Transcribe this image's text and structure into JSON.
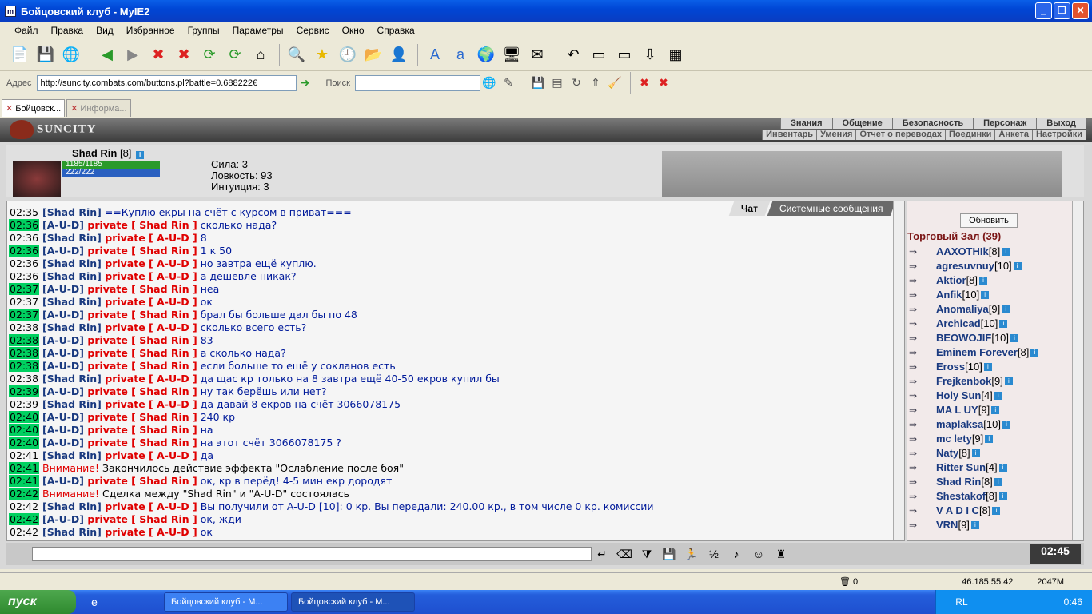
{
  "window": {
    "title": "Бойцовский клуб - MyIE2"
  },
  "menu": [
    "Файл",
    "Правка",
    "Вид",
    "Избранное",
    "Группы",
    "Параметры",
    "Сервис",
    "Окно",
    "Справка"
  ],
  "address": {
    "label": "Адрес",
    "url": "http://suncity.combats.com/buttons.pl?battle=0.688222€",
    "search_label": "Поиск"
  },
  "tabs": [
    "Бойцовск...",
    "Информа..."
  ],
  "game": {
    "logo": "SUNCITY",
    "nav_top": [
      "Знания",
      "Общение",
      "Безопасность",
      "Персонаж",
      "Выход"
    ],
    "nav_sub": [
      "Инвентарь",
      "Умения",
      "Отчет о переводах",
      "Поединки",
      "Анкета",
      "Настройки"
    ],
    "character": {
      "name": "Shad Rin",
      "level": "[8]",
      "hp": "1185/1185",
      "mp": "222/222",
      "stats": [
        "Сила: 3",
        "Ловкость: 93",
        "Интуиция: 3"
      ]
    },
    "chat_tabs": [
      "Чат",
      "Системные сообщения"
    ],
    "messages": [
      {
        "time": "02:35",
        "hl": false,
        "from": "[Shad Rin]",
        "to": "",
        "text": "==Куплю екры на счёт с курсом в приват==="
      },
      {
        "time": "02:36",
        "hl": true,
        "from": "[A-U-D]",
        "to": "private [ Shad Rin ]",
        "text": "сколько нада?"
      },
      {
        "time": "02:36",
        "hl": false,
        "from": "[Shad Rin]",
        "to": "private [ A-U-D ]",
        "text": "8"
      },
      {
        "time": "02:36",
        "hl": true,
        "from": "[A-U-D]",
        "to": "private [ Shad Rin ]",
        "text": "1 к 50"
      },
      {
        "time": "02:36",
        "hl": false,
        "from": "[Shad Rin]",
        "to": "private [ A-U-D ]",
        "text": "но завтра ещё куплю."
      },
      {
        "time": "02:36",
        "hl": false,
        "from": "[Shad Rin]",
        "to": "private [ A-U-D ]",
        "text": "а дешевле никак?"
      },
      {
        "time": "02:37",
        "hl": true,
        "from": "[A-U-D]",
        "to": "private [ Shad Rin ]",
        "text": "неа"
      },
      {
        "time": "02:37",
        "hl": false,
        "from": "[Shad Rin]",
        "to": "private [ A-U-D ]",
        "text": "ок"
      },
      {
        "time": "02:37",
        "hl": true,
        "from": "[A-U-D]",
        "to": "private [ Shad Rin ]",
        "text": "брал бы больше дал бы по 48"
      },
      {
        "time": "02:38",
        "hl": false,
        "from": "[Shad Rin]",
        "to": "private [ A-U-D ]",
        "text": "сколько всего есть?"
      },
      {
        "time": "02:38",
        "hl": true,
        "from": "[A-U-D]",
        "to": "private [ Shad Rin ]",
        "text": "83"
      },
      {
        "time": "02:38",
        "hl": true,
        "from": "[A-U-D]",
        "to": "private [ Shad Rin ]",
        "text": "а сколько нада?"
      },
      {
        "time": "02:38",
        "hl": true,
        "from": "[A-U-D]",
        "to": "private [ Shad Rin ]",
        "text": "если больше то ещё у сокланов есть"
      },
      {
        "time": "02:38",
        "hl": false,
        "from": "[Shad Rin]",
        "to": "private [ A-U-D ]",
        "text": "да щас кр только на 8 завтра ещё 40-50 екров купил бы"
      },
      {
        "time": "02:39",
        "hl": true,
        "from": "[A-U-D]",
        "to": "private [ Shad Rin ]",
        "text": "ну так берёшь или нет?"
      },
      {
        "time": "02:39",
        "hl": false,
        "from": "[Shad Rin]",
        "to": "private [ A-U-D ]",
        "text": "да давай 8 екров на счёт 3066078175"
      },
      {
        "time": "02:40",
        "hl": true,
        "from": "[A-U-D]",
        "to": "private [ Shad Rin ]",
        "text": "240 кр"
      },
      {
        "time": "02:40",
        "hl": true,
        "from": "[A-U-D]",
        "to": "private [ Shad Rin ]",
        "text": "на"
      },
      {
        "time": "02:40",
        "hl": true,
        "from": "[A-U-D]",
        "to": "private [ Shad Rin ]",
        "text": "на этот счёт 3066078175 ?"
      },
      {
        "time": "02:41",
        "hl": false,
        "from": "[Shad Rin]",
        "to": "private [ A-U-D ]",
        "text": "да"
      },
      {
        "time": "02:41",
        "hl": true,
        "warn": "Внимание!",
        "sys": "Закончилось действие эффекта \"Ослабление после боя\""
      },
      {
        "time": "02:41",
        "hl": true,
        "from": "[A-U-D]",
        "to": "private [ Shad Rin ]",
        "text": "ок, кр в перёд! 4-5 мин екр дородят"
      },
      {
        "time": "02:42",
        "hl": true,
        "warn": "Внимание!",
        "sys": "Сделка между \"Shad Rin\" и \"A-U-D\" состоялась"
      },
      {
        "time": "02:42",
        "hl": false,
        "from": "[Shad Rin]",
        "to": "private [ A-U-D ]",
        "text": "Вы получили от A-U-D [10]: 0 кр. Вы передали: 240.00 кр., в том числе 0 кр. комиссии"
      },
      {
        "time": "02:42",
        "hl": true,
        "from": "[A-U-D]",
        "to": "private [ Shad Rin ]",
        "text": "ок, жди"
      },
      {
        "time": "02:42",
        "hl": false,
        "from": "[Shad Rin]",
        "to": "private [ A-U-D ]",
        "text": "ок"
      }
    ],
    "room": {
      "refresh_label": "Обновить",
      "title": "Торговый Зал (39)",
      "users": [
        {
          "name": "AAXOTHIk",
          "lvl": "[8]"
        },
        {
          "name": "agresuvnuy",
          "lvl": "[10]"
        },
        {
          "name": "Aktior",
          "lvl": "[8]"
        },
        {
          "name": "Anfik",
          "lvl": "[10]"
        },
        {
          "name": "Anomaliya",
          "lvl": "[9]"
        },
        {
          "name": "Archicad",
          "lvl": "[10]"
        },
        {
          "name": "BEOWOJIF",
          "lvl": "[10]"
        },
        {
          "name": "Eminem Forever",
          "lvl": "[8]"
        },
        {
          "name": "Eross",
          "lvl": "[10]"
        },
        {
          "name": "Frejkenbok",
          "lvl": "[9]"
        },
        {
          "name": "Holy Sun",
          "lvl": "[4]"
        },
        {
          "name": "MA L UY",
          "lvl": "[9]"
        },
        {
          "name": "maplaksa",
          "lvl": "[10]"
        },
        {
          "name": "mc lety",
          "lvl": "[9]"
        },
        {
          "name": "Naty",
          "lvl": "[8]"
        },
        {
          "name": "Ritter Sun",
          "lvl": "[4]"
        },
        {
          "name": "Shad Rin",
          "lvl": "[8]"
        },
        {
          "name": "Shestakof",
          "lvl": "[8]"
        },
        {
          "name": "V A D I C",
          "lvl": "[8]"
        },
        {
          "name": "VRN",
          "lvl": "[9]"
        }
      ]
    },
    "clock": "02:45"
  },
  "statusbar": {
    "count": "0",
    "ip": "46.185.55.42",
    "mem": "2047M"
  },
  "taskbar": {
    "start": "пуск",
    "items": [
      "Бойцовский клуб - M...",
      "Бойцовский клуб - M..."
    ],
    "lang": "RL",
    "time": "0:46"
  }
}
